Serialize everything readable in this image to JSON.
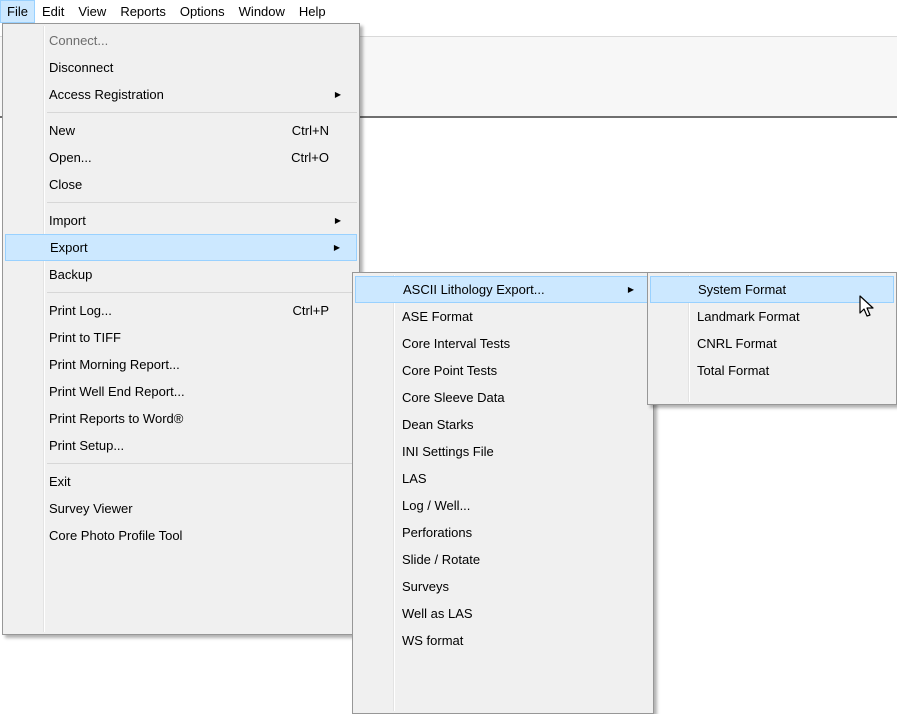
{
  "menubar": {
    "items": [
      "File",
      "Edit",
      "View",
      "Reports",
      "Options",
      "Window",
      "Help"
    ],
    "active": "File"
  },
  "file_menu": {
    "items": [
      {
        "label": "Connect...",
        "disabled": true
      },
      {
        "label": "Disconnect"
      },
      {
        "label": "Access Registration",
        "submenu": true
      },
      {
        "sep": true
      },
      {
        "label": "New",
        "shortcut": "Ctrl+N"
      },
      {
        "label": "Open...",
        "shortcut": "Ctrl+O"
      },
      {
        "label": "Close"
      },
      {
        "sep": true
      },
      {
        "label": "Import",
        "submenu": true
      },
      {
        "label": "Export",
        "submenu": true,
        "highlight": true
      },
      {
        "label": "Backup"
      },
      {
        "sep": true
      },
      {
        "label": "Print Log...",
        "shortcut": "Ctrl+P"
      },
      {
        "label": "Print to TIFF"
      },
      {
        "label": "Print Morning Report..."
      },
      {
        "label": "Print Well End Report..."
      },
      {
        "label": "Print Reports to Word®"
      },
      {
        "label": "Print Setup..."
      },
      {
        "sep": true
      },
      {
        "label": "Exit"
      },
      {
        "label": "Survey Viewer"
      },
      {
        "label": "Core Photo Profile Tool"
      }
    ]
  },
  "export_menu": {
    "items": [
      {
        "label": "ASCII Lithology Export...",
        "submenu": true,
        "highlight": true
      },
      {
        "label": "ASE Format"
      },
      {
        "label": "Core Interval Tests"
      },
      {
        "label": "Core Point Tests"
      },
      {
        "label": "Core Sleeve Data"
      },
      {
        "label": "Dean Starks"
      },
      {
        "label": "INI Settings File"
      },
      {
        "label": "LAS"
      },
      {
        "label": "Log / Well..."
      },
      {
        "label": "Perforations"
      },
      {
        "label": "Slide / Rotate"
      },
      {
        "label": "Surveys"
      },
      {
        "label": "Well as LAS"
      },
      {
        "label": "WS format"
      }
    ]
  },
  "ascii_menu": {
    "items": [
      {
        "label": "System Format",
        "highlight": true
      },
      {
        "label": "Landmark Format"
      },
      {
        "label": "CNRL Format"
      },
      {
        "label": "Total Format"
      }
    ]
  },
  "icons": {
    "submenu_arrow": "submenu-arrow-icon",
    "cursor": "mouse-pointer-icon"
  },
  "colors": {
    "highlight_bg": "#cce8ff",
    "highlight_border": "#99d1ff",
    "menu_bg": "#f0f0f0"
  }
}
